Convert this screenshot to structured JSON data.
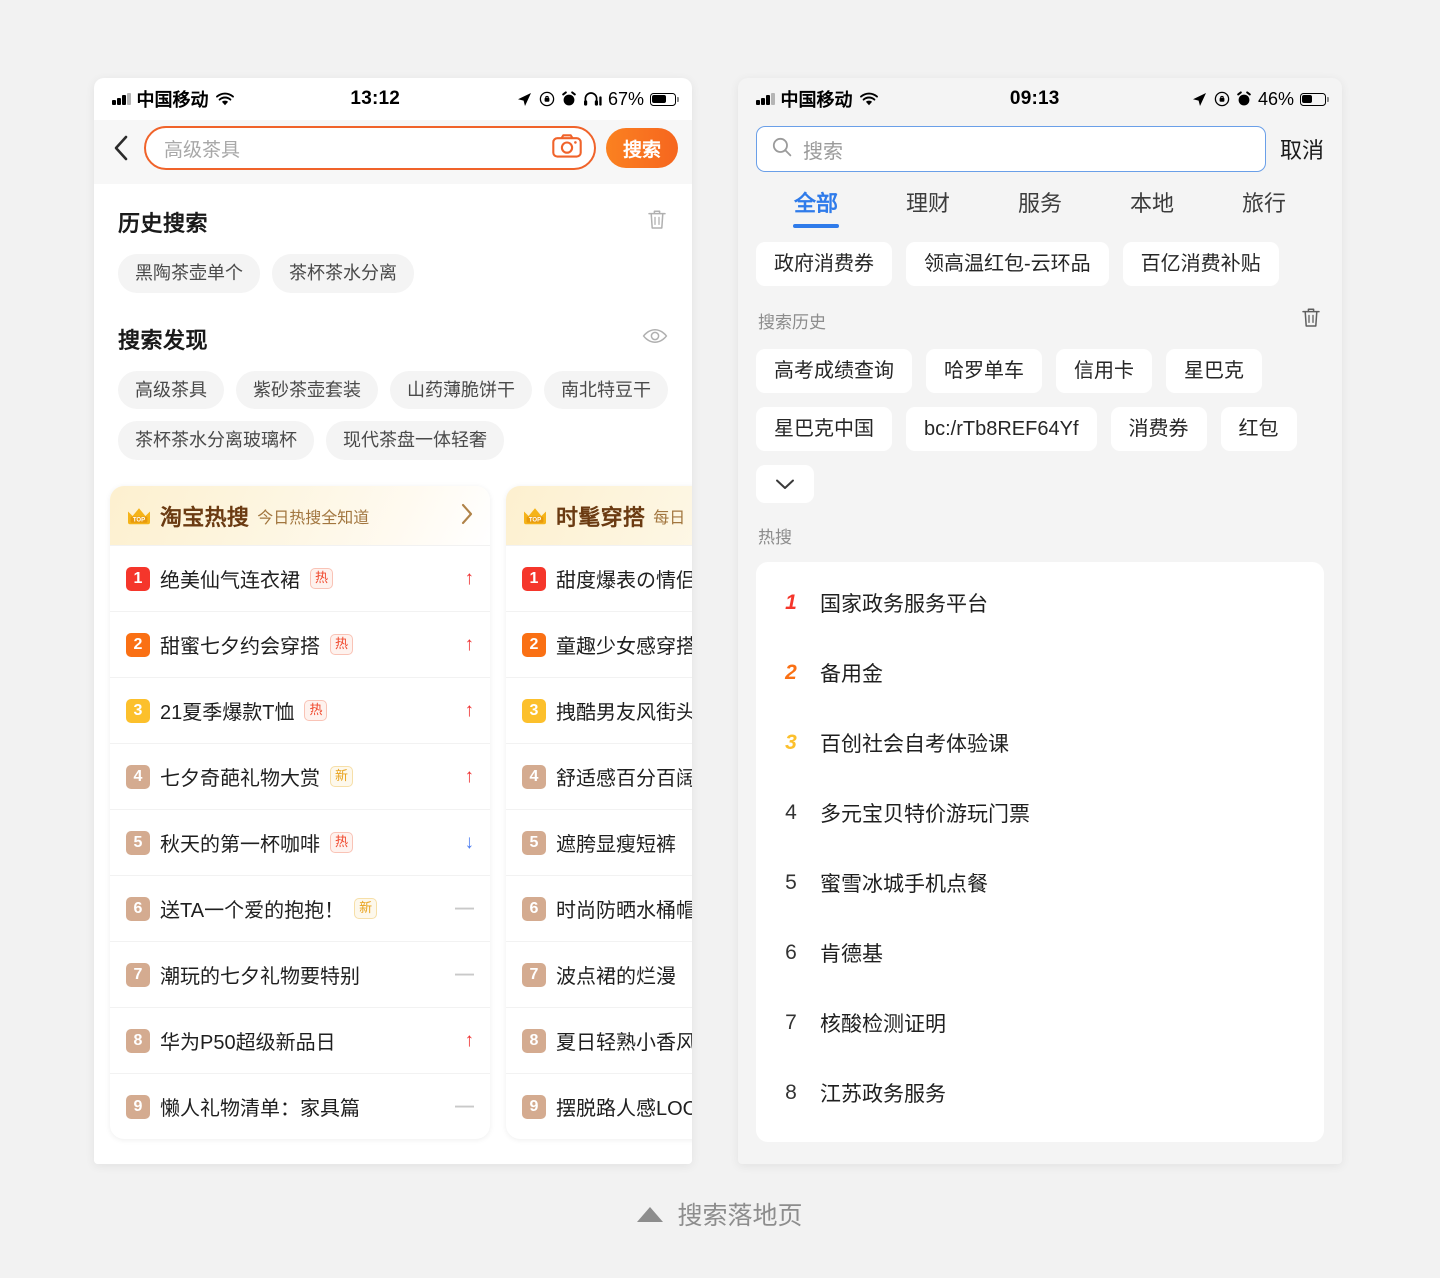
{
  "caption": {
    "label": "搜索落地页",
    "icon": "triangle-up-icon"
  },
  "left_phone": {
    "status": {
      "carrier": "中国移动",
      "time": "13:12",
      "battery_pct": "67%",
      "icons": [
        "signal-bars-icon",
        "wifi-icon",
        "location-arrow-icon",
        "rotation-lock-icon",
        "alarm-icon",
        "headphones-icon",
        "battery-icon"
      ]
    },
    "search": {
      "placeholder": "高级茶具",
      "button_label": "搜索",
      "back_icon": "chevron-left-icon",
      "camera_icon": "camera-icon"
    },
    "history": {
      "title": "历史搜索",
      "clear_icon": "trash-icon",
      "items": [
        "黑陶茶壶单个",
        "茶杯茶水分离"
      ]
    },
    "discovery": {
      "title": "搜索发现",
      "toggle_icon": "eye-icon",
      "items": [
        "高级茶具",
        "紫砂茶壶套装",
        "山药薄脆饼干",
        "南北特豆干",
        "茶杯茶水分离玻璃杯",
        "现代茶盘一体轻奢"
      ]
    },
    "hot_cards": [
      {
        "badge_icon": "crown-top-icon",
        "badge_text": "TOP",
        "title": "淘宝热搜",
        "subtitle": "今日热搜全知道",
        "arrow_icon": "chevron-right-icon",
        "rows": [
          {
            "rank": "1",
            "text": "绝美仙气连衣裙",
            "tag": "热",
            "trend": "up"
          },
          {
            "rank": "2",
            "text": "甜蜜七夕约会穿搭",
            "tag": "热",
            "trend": "up"
          },
          {
            "rank": "3",
            "text": "21夏季爆款T恤",
            "tag": "热",
            "trend": "up"
          },
          {
            "rank": "4",
            "text": "七夕奇葩礼物大赏",
            "tag": "新",
            "trend": "up"
          },
          {
            "rank": "5",
            "text": "秋天的第一杯咖啡",
            "tag": "热",
            "trend": "down"
          },
          {
            "rank": "6",
            "text": "送TA一个爱的抱抱！",
            "tag": "新",
            "trend": "flat"
          },
          {
            "rank": "7",
            "text": "潮玩的七夕礼物要特别",
            "tag": "",
            "trend": "flat"
          },
          {
            "rank": "8",
            "text": "华为P50超级新品日",
            "tag": "",
            "trend": "up"
          },
          {
            "rank": "9",
            "text": "懒人礼物清单：家具篇",
            "tag": "",
            "trend": "flat"
          }
        ]
      },
      {
        "badge_icon": "crown-top-icon",
        "badge_text": "TOP",
        "title": "时髦穿搭",
        "subtitle": "每日",
        "arrow_icon": "chevron-right-icon",
        "rows": [
          {
            "rank": "1",
            "text": "甜度爆表の情侣",
            "tag": "",
            "trend": ""
          },
          {
            "rank": "2",
            "text": "童趣少女感穿搭",
            "tag": "",
            "trend": ""
          },
          {
            "rank": "3",
            "text": "拽酷男友风街头",
            "tag": "",
            "trend": ""
          },
          {
            "rank": "4",
            "text": "舒适感百分百阔",
            "tag": "",
            "trend": ""
          },
          {
            "rank": "5",
            "text": "遮胯显瘦短裤",
            "tag": "",
            "trend": ""
          },
          {
            "rank": "6",
            "text": "时尚防晒水桶帽",
            "tag": "",
            "trend": ""
          },
          {
            "rank": "7",
            "text": "波点裙的烂漫",
            "tag": "",
            "trend": ""
          },
          {
            "rank": "8",
            "text": "夏日轻熟小香风",
            "tag": "",
            "trend": ""
          },
          {
            "rank": "9",
            "text": "摆脱路人感LOO",
            "tag": "",
            "trend": ""
          }
        ]
      }
    ]
  },
  "right_phone": {
    "status": {
      "carrier": "中国移动",
      "time": "09:13",
      "battery_pct": "46%",
      "icons": [
        "signal-bars-icon",
        "wifi-icon",
        "location-arrow-icon",
        "rotation-lock-icon",
        "alarm-icon",
        "battery-icon"
      ]
    },
    "search": {
      "placeholder": "搜索",
      "cancel_label": "取消",
      "search_icon": "magnifier-icon"
    },
    "tabs": [
      {
        "label": "全部",
        "active": true
      },
      {
        "label": "理财",
        "active": false
      },
      {
        "label": "服务",
        "active": false
      },
      {
        "label": "本地",
        "active": false
      },
      {
        "label": "旅行",
        "active": false
      }
    ],
    "promo_chips": [
      "政府消费券",
      "领高温红包-云环品",
      "百亿消费补贴"
    ],
    "history": {
      "title": "搜索历史",
      "clear_icon": "trash-icon",
      "items": [
        "高考成绩查询",
        "哈罗单车",
        "信用卡",
        "星巴克",
        "星巴克中国",
        "bc:/rTb8REF64Yf",
        "消费券",
        "红包"
      ],
      "expand_icon": "chevron-down-icon"
    },
    "hot": {
      "title": "热搜",
      "items": [
        {
          "rank": "1",
          "text": "国家政务服务平台"
        },
        {
          "rank": "2",
          "text": "备用金"
        },
        {
          "rank": "3",
          "text": "百创社会自考体验课"
        },
        {
          "rank": "4",
          "text": "多元宝贝特价游玩门票"
        },
        {
          "rank": "5",
          "text": "蜜雪冰城手机点餐"
        },
        {
          "rank": "6",
          "text": "肯德基"
        },
        {
          "rank": "7",
          "text": "核酸检测证明"
        },
        {
          "rank": "8",
          "text": "江苏政务服务"
        }
      ]
    }
  },
  "colors": {
    "accent_orange": "#f0632a",
    "accent_blue": "#2f7bea",
    "rank1": "#f5362b",
    "rank2": "#fa7014",
    "rank3": "#fcc02c",
    "rank_rest": "#d4ab90",
    "trend_up": "#ee2f2f",
    "trend_down": "#4d7df0",
    "trend_flat": "#c9c9c9"
  }
}
